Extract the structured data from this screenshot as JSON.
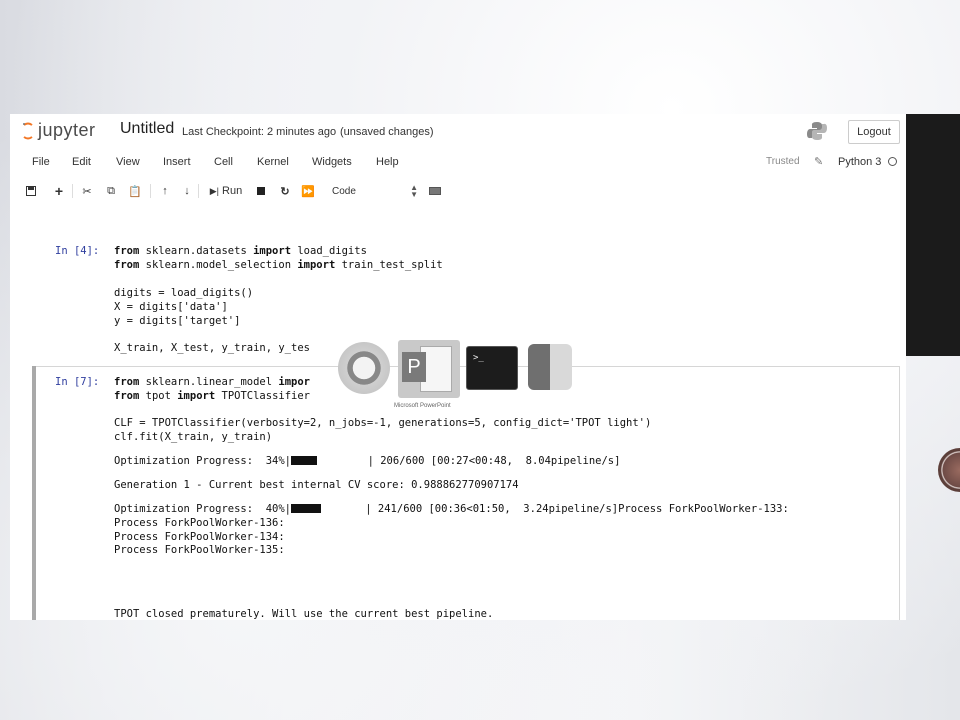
{
  "header": {
    "logo_text": "jupyter",
    "notebook_name": "Untitled",
    "checkpoint": "Last Checkpoint: 2 minutes ago",
    "unsaved": "(unsaved changes)",
    "logout_label": "Logout"
  },
  "menubar": {
    "items": [
      "File",
      "Edit",
      "View",
      "Insert",
      "Cell",
      "Kernel",
      "Widgets",
      "Help"
    ],
    "trusted": "Trusted",
    "kernel_name": "Python 3"
  },
  "toolbar": {
    "run_label": "Run",
    "cell_type": "Code"
  },
  "cells": [
    {
      "prompt": "In [4]:",
      "lines": [
        "from sklearn.datasets import load_digits",
        "from sklearn.model_selection import train_test_split",
        "",
        "digits = load_digits()",
        "X = digits['data']",
        "y = digits['target']",
        "",
        "X_train, X_test, y_train, y_tes"
      ]
    },
    {
      "prompt": "In [7]:",
      "lines": [
        "from sklearn.linear_model impor",
        "from tpot import TPOTClassifier",
        "",
        "CLF = TPOTClassifier(verbosity=2, n_jobs=-1, generations=5, config_dict='TPOT light')",
        "clf.fit(X_train, y_train)"
      ],
      "output": {
        "progress1_prefix": "Optimization Progress:  34%|",
        "progress1_suffix": "        | 206/600 [00:27<00:48,  8.04pipeline/s]",
        "generation_line": "Generation 1 - Current best internal CV score: 0.988862770907174",
        "progress2_prefix": "Optimization Progress:  40%|",
        "progress2_suffix": "       | 241/600 [00:36<01:50,  3.24pipeline/s]Process ForkPoolWorker-133:",
        "process_lines": [
          "Process ForkPoolWorker-136:",
          "Process ForkPoolWorker-134:",
          "Process ForkPoolWorker-135:"
        ],
        "closed_line": "TPOT closed prematurely. Will use the current best pipeline."
      }
    }
  ],
  "dock": {
    "ppt_label": "Microsoft PowerPoint",
    "terminal_glyph": ">_"
  }
}
